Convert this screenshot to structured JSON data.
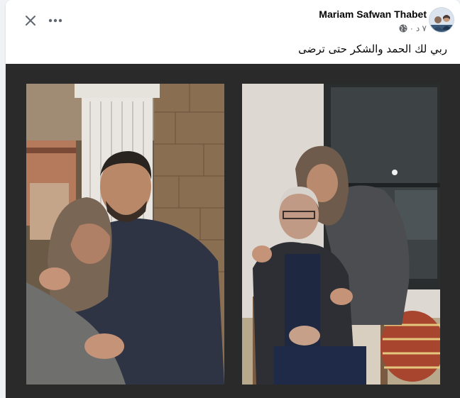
{
  "post": {
    "author": "Mariam Safwan Thabet",
    "time": "٧ د",
    "dot": "·",
    "text": "ربي لك الحمد والشكر حتى ترضى",
    "privacy_icon": "globe-icon"
  },
  "toolbar": {
    "close_icon": "close-icon",
    "more_icon": "more-horizontal-icon"
  },
  "photos": [
    {
      "name": "photo-1",
      "subject": "woman in hijab hugging man in navy sweater"
    },
    {
      "name": "photo-2",
      "subject": "woman in hijab hugging seated elderly man"
    }
  ],
  "colors": {
    "photo_background": "#2b2a2b",
    "text_primary": "#050505",
    "text_secondary": "#65676b"
  }
}
